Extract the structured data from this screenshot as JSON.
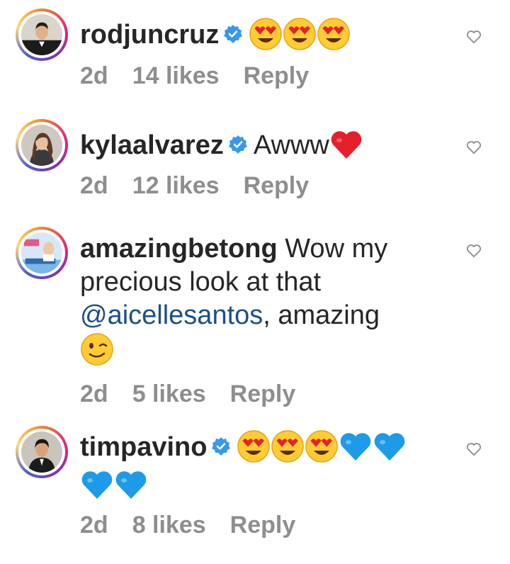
{
  "comments": [
    {
      "username": "rodjuncruz",
      "verified": true,
      "text_before": "",
      "mention": "",
      "text_after": "",
      "emojis": [
        "heart-eyes-emoji",
        "heart-eyes-emoji",
        "heart-eyes-emoji"
      ],
      "time": "2d",
      "likes": "14 likes",
      "reply": "Reply"
    },
    {
      "username": "kylaalvarez",
      "verified": true,
      "text_before": "Awww",
      "mention": "",
      "text_after": "",
      "emojis": [
        "red-heart-emoji"
      ],
      "time": "2d",
      "likes": "12 likes",
      "reply": "Reply"
    },
    {
      "username": "amazingbetong",
      "verified": false,
      "text_before": "Wow my precious look at that",
      "mention": "@aicellesantos",
      "text_after": ", amazing",
      "emojis": [
        "wink-emoji"
      ],
      "time": "2d",
      "likes": "5 likes",
      "reply": "Reply"
    },
    {
      "username": "timpavino",
      "verified": true,
      "text_before": "",
      "mention": "",
      "text_after": "",
      "emojis": [
        "heart-eyes-emoji",
        "heart-eyes-emoji",
        "heart-eyes-emoji",
        "blue-heart-emoji",
        "blue-heart-emoji",
        "blue-heart-emoji",
        "blue-heart-emoji"
      ],
      "time": "2d",
      "likes": "8 likes",
      "reply": "Reply"
    }
  ],
  "colors": {
    "text": "#262626",
    "meta": "#8e8e8e",
    "mention": "#1c4e8a",
    "verified": "#3897f0"
  },
  "icons": {
    "like": "heart-outline-icon",
    "verified": "verified-badge-icon"
  }
}
